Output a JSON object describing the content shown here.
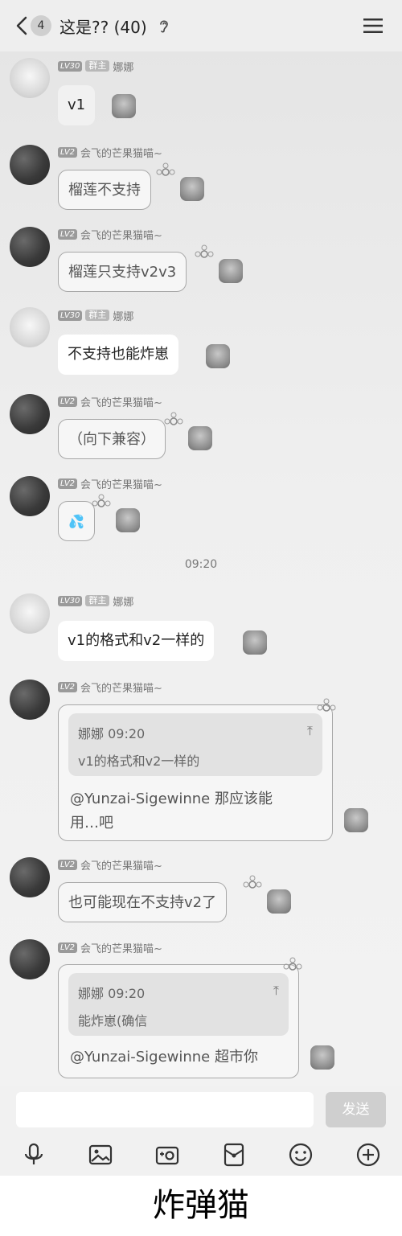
{
  "header": {
    "back_count": "4",
    "title": "这是?? (40)"
  },
  "users": {
    "nana": {
      "level": "LV30",
      "role": "群主",
      "name": "娜娜"
    },
    "mango": {
      "level": "LV2",
      "name": "会飞的芒果猫喵~"
    }
  },
  "messages": [
    {
      "text": "v1"
    },
    {
      "text": "榴莲不支持"
    },
    {
      "text": "榴莲只支持v2v3"
    },
    {
      "text": "不支持也能炸崽"
    },
    {
      "text": "（向下兼容）"
    },
    {
      "text": "💦"
    },
    {
      "text": "v1的格式和v2一样的"
    },
    {
      "quote_header": "娜娜 09:20",
      "quote_text": "v1的格式和v2一样的",
      "reply_line1": "@Yunzai-Sigewinne 那应该能",
      "reply_line2": "用…吧"
    },
    {
      "text": "也可能现在不支持v2了"
    },
    {
      "quote_header": "娜娜 09:20",
      "quote_text": "能炸崽(确信",
      "reply_line1": "@Yunzai-Sigewinne 超市你"
    }
  ],
  "timestamp": "09:20",
  "input": {
    "placeholder": "",
    "send_label": "发送"
  },
  "toolbar_icons": [
    "microphone-icon",
    "image-icon",
    "camera-icon",
    "red-packet-icon",
    "emoji-icon",
    "plus-icon"
  ],
  "caption": "炸弹猫"
}
